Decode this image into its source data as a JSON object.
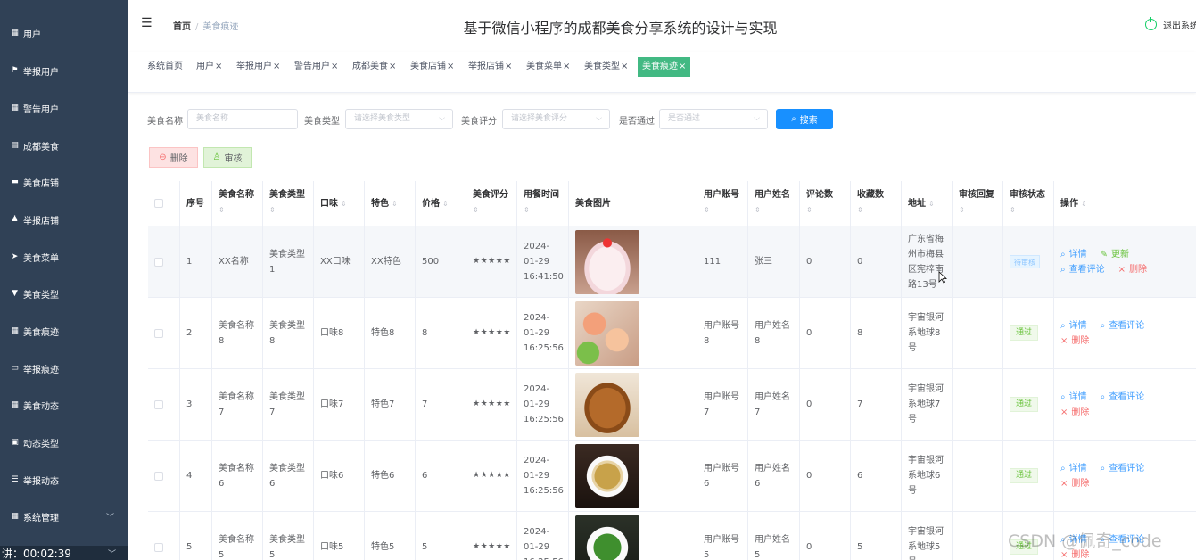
{
  "sidebar": {
    "items": [
      {
        "label": "用户",
        "icon": "grid-icon"
      },
      {
        "label": "举报用户",
        "icon": "flag-icon"
      },
      {
        "label": "警告用户",
        "icon": "grid-icon"
      },
      {
        "label": "成都美食",
        "icon": "clipboard-icon"
      },
      {
        "label": "美食店铺",
        "icon": "monitor-icon"
      },
      {
        "label": "举报店铺",
        "icon": "user-icon"
      },
      {
        "label": "美食菜单",
        "icon": "send-icon"
      },
      {
        "label": "美食类型",
        "icon": "cup-icon"
      },
      {
        "label": "美食痕迹",
        "icon": "grid-icon"
      },
      {
        "label": "举报痕迹",
        "icon": "card-icon"
      },
      {
        "label": "美食动态",
        "icon": "grid-icon"
      },
      {
        "label": "动态类型",
        "icon": "clipboard-check-icon"
      },
      {
        "label": "举报动态",
        "icon": "sliders-icon"
      },
      {
        "label": "系统管理",
        "icon": "grid-icon"
      }
    ],
    "recording": "讲：00:02:39"
  },
  "header": {
    "breadcrumb_home": "首页",
    "breadcrumb_current": "美食痕迹",
    "title": "基于微信小程序的成都美食分享系统的设计与实现",
    "logout": "退出系统"
  },
  "tabs": [
    "系统首页",
    "用户",
    "举报用户",
    "警告用户",
    "成都美食",
    "美食店铺",
    "举报店铺",
    "美食菜单",
    "美食类型",
    "美食痕迹"
  ],
  "search": {
    "name_label": "美食名称",
    "name_placeholder": "美食名称",
    "type_label": "美食类型",
    "type_placeholder": "请选择美食类型",
    "rating_label": "美食评分",
    "rating_placeholder": "请选择美食评分",
    "pass_label": "是否通过",
    "pass_placeholder": "是否通过",
    "search_button": "搜索"
  },
  "actions": {
    "delete": "删除",
    "audit": "审核"
  },
  "table": {
    "headers": [
      "序号",
      "美食名称",
      "美食类型",
      "口味",
      "特色",
      "价格",
      "美食评分",
      "用餐时间",
      "美食图片",
      "用户账号",
      "用户姓名",
      "评论数",
      "收藏数",
      "地址",
      "审核回复",
      "审核状态",
      "操作"
    ],
    "ops": {
      "detail": "详情",
      "update": "更新",
      "view_comments": "查看评论",
      "delete": "删除"
    },
    "rows": [
      {
        "no": "1",
        "name": "XX名称",
        "type": "美食类型1",
        "taste": "XX口味",
        "feature": "XX特色",
        "price": "500",
        "rating": "★★★★★",
        "time": "2024-01-29 16:41:50",
        "account": "111",
        "username": "张三",
        "comments": "0",
        "favs": "0",
        "address": "广东省梅州市梅县区宪梓南路13号",
        "reply": "",
        "status": "待审核",
        "image": "cake"
      },
      {
        "no": "2",
        "name": "美食名称8",
        "type": "美食类型8",
        "taste": "口味8",
        "feature": "特色8",
        "price": "8",
        "rating": "★★★★★",
        "time": "2024-01-29 16:25:56",
        "account": "用户账号8",
        "username": "用户姓名8",
        "comments": "0",
        "favs": "8",
        "address": "宇宙银河系地球8号",
        "reply": "",
        "status": "通过",
        "image": "sushi"
      },
      {
        "no": "3",
        "name": "美食名称7",
        "type": "美食类型7",
        "taste": "口味7",
        "feature": "特色7",
        "price": "7",
        "rating": "★★★★★",
        "time": "2024-01-29 16:25:56",
        "account": "用户账号7",
        "username": "用户姓名7",
        "comments": "0",
        "favs": "7",
        "address": "宇宙银河系地球7号",
        "reply": "",
        "status": "通过",
        "image": "meat"
      },
      {
        "no": "4",
        "name": "美食名称6",
        "type": "美食类型6",
        "taste": "口味6",
        "feature": "特色6",
        "price": "6",
        "rating": "★★★★★",
        "time": "2024-01-29 16:25:56",
        "account": "用户账号6",
        "username": "用户姓名6",
        "comments": "0",
        "favs": "6",
        "address": "宇宙银河系地球6号",
        "reply": "",
        "status": "通过",
        "image": "stirfry"
      },
      {
        "no": "5",
        "name": "美食名称5",
        "type": "美食类型5",
        "taste": "口味5",
        "feature": "特色5",
        "price": "5",
        "rating": "★★★★★",
        "time": "2024-01-29 16:25:56",
        "account": "用户账号5",
        "username": "用户姓名5",
        "comments": "0",
        "favs": "5",
        "address": "宇宙银河系地球5号",
        "reply": "",
        "status": "通过",
        "image": "greens"
      }
    ]
  },
  "watermark": "CSDN @佩奇_code",
  "colors": {
    "sidebar_bg": "#304156",
    "active_tab": "#42b983",
    "primary": "#1890ff",
    "success": "#67c23a",
    "danger": "#f56c6c"
  }
}
